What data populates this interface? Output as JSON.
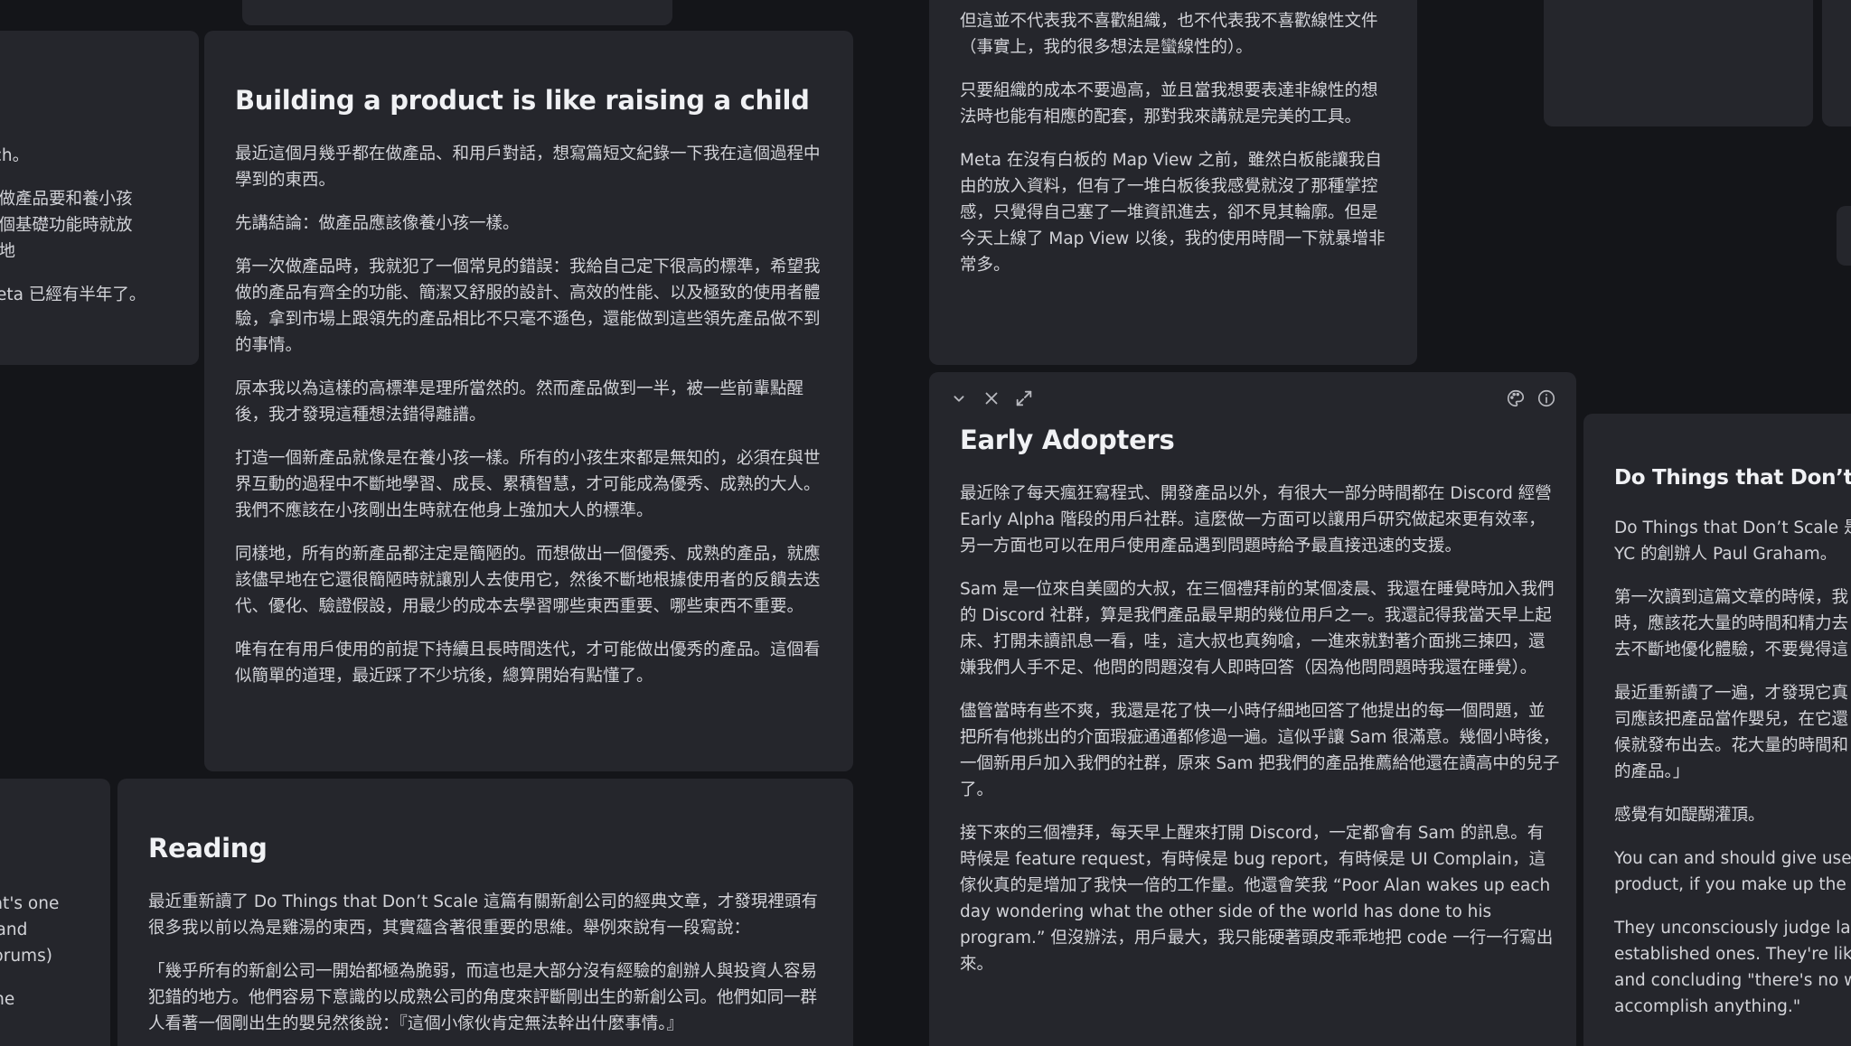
{
  "cards": {
    "partial_left_top": {
      "paragraphs": [
        "nch。",
        "是做產品要和養小孩\n兩個基礎功能時就放\n慢地",
        "Meta 已經有半年了。"
      ]
    },
    "building_product": {
      "title": "Building a product is like raising a child",
      "paragraphs": [
        "最近這個月幾乎都在做產品、和用戶對話，想寫篇短文紀錄一下我在這個過程中學到的東西。",
        "先講結論：做產品應該像養小孩一樣。",
        "第一次做產品時，我就犯了一個常見的錯誤：我給自己定下很高的標準，希望我做的產品有齊全的功能、簡潔又舒服的設計、高效的性能、以及極致的使用者體驗，拿到市場上跟領先的產品相比不只毫不遜色，還能做到這些領先產品做不到的事情。",
        "原本我以為這樣的高標準是理所當然的。然而產品做到一半，被一些前輩點醒後，我才發現這種想法錯得離譜。",
        "打造一個新產品就像是在養小孩一樣。所有的小孩生來都是無知的，必須在與世界互動的過程中不斷地學習、成長、累積智慧，才可能成為優秀、成熟的大人。我們不應該在小孩剛出生時就在他身上強加大人的標準。",
        "同樣地，所有的新產品都注定是簡陋的。而想做出一個優秀、成熟的產品，就應該儘早地在它還很簡陋時就讓別人去使用它，然後不斷地根據使用者的反饋去迭代、優化、驗證假設，用最少的成本去學習哪些東西重要、哪些東西不重要。",
        "唯有在有用戶使用的前提下持續且長時間迭代，才可能做出優秀的產品。這個看似簡單的道理，最近踩了不少坑後，總算開始有點懂了。"
      ]
    },
    "partial_left_bottom": {
      "paragraphs": [
        "hat's one\ns and\n forums)",
        " the"
      ]
    },
    "reading": {
      "title": "Reading",
      "paragraphs": [
        "最近重新讀了 Do Things that Don’t Scale 這篇有關新創公司的經典文章，才發現裡頭有很多我以前以為是雞湯的東西，其實蘊含著很重要的思維。舉例來說有一段寫說：",
        "「幾乎所有的新創公司一開始都極為脆弱，而這也是大部分沒有經驗的創辦人與投資人容易犯錯的地方。他們容易下意識的以成熟公司的角度來評斷剛出生的新創公司。他們如同一群人看著一個剛出生的嬰兒然後說：『這個小傢伙肯定無法幹出什麼事情。』"
      ]
    },
    "organization": {
      "paragraphs": [
        "但這並不代表我不喜歡組織，也不代表我不喜歡線性文件（事實上，我的很多想法是蠻線性的）。",
        "只要組織的成本不要過高，並且當我想要表達非線性的想法時也能有相應的配套，那對我來講就是完美的工具。",
        "Meta 在沒有白板的 Map View 之前，雖然白板能讓我自由的放入資料，但有了一堆白板後我感覺就沒了那種掌控感，只覺得自己塞了一堆資訊進去，卻不見其輪廓。但是今天上線了 Map View 以後，我的使用時間一下就暴增非常多。"
      ]
    },
    "early_adopters": {
      "title": "Early Adopters",
      "paragraphs": [
        "最近除了每天瘋狂寫程式、開發產品以外，有很大一部分時間都在 Discord 經營 Early Alpha 階段的用戶社群。這麼做一方面可以讓用戶研究做起來更有效率，另一方面也可以在用戶使用產品遇到問題時給予最直接迅速的支援。",
        "Sam 是一位來自美國的大叔，在三個禮拜前的某個凌晨、我還在睡覺時加入我們的 Discord 社群，算是我們產品最早期的幾位用戶之一。我還記得我當天早上起床、打開未讀訊息一看，哇，這大叔也真夠嗆，一進來就對著介面挑三揀四，還嫌我們人手不足、他問的問題沒有人即時回答（因為他問問題時我還在睡覺）。",
        "儘管當時有些不爽，我還是花了快一小時仔細地回答了他提出的每一個問題，並把所有他挑出的介面瑕疵通通都修過一遍。這似乎讓 Sam 很滿意。幾個小時後，一個新用戶加入我們的社群，原來 Sam 把我們的產品推薦給他還在讀高中的兒子了。",
        "接下來的三個禮拜，每天早上醒來打開 Discord，一定都會有 Sam 的訊息。有時候是 feature request，有時候是 bug report，有時候是 UI Complain，這傢伙真的是增加了我快一倍的工作量。他還會笑我 “Poor Alan wakes up each day wondering what the other side of the world has done to his program.” 但沒辦法，用戶最大，我只能硬著頭皮乖乖地把 code 一行一行寫出來。"
      ]
    },
    "do_things": {
      "title": "Do Things that Don’t Scale",
      "paragraphs": [
        "Do Things that Don’t Scale 是\nYC 的創辦人 Paul Graham。",
        "第一次讀到這篇文章的時候，我\n時，應該花大量的時間和精力去\n去不斷地優化體驗，不要覺得這",
        "最近重新讀了一遍，才發現它真\n司應該把產品當作嬰兒，在它還\n候就發布出去。花大量的時間和\n的產品。」",
        "感覺有如醍醐灌頂。",
        "You can and should give users\nproduct, if you make up the di",
        "They unconsciously judge larv\nestablished ones. They're like\nand concluding \"there's no wa\naccomplish anything.\""
      ]
    }
  },
  "toolbar": {
    "icons": [
      "chevron-down-icon",
      "close-icon",
      "expand-icon",
      "palette-icon",
      "info-icon"
    ]
  },
  "colors": {
    "background": "#141519",
    "card": "#25262c",
    "text": "#d2d3d8",
    "title": "#f0f1f4",
    "icon": "#b8b9bf"
  }
}
